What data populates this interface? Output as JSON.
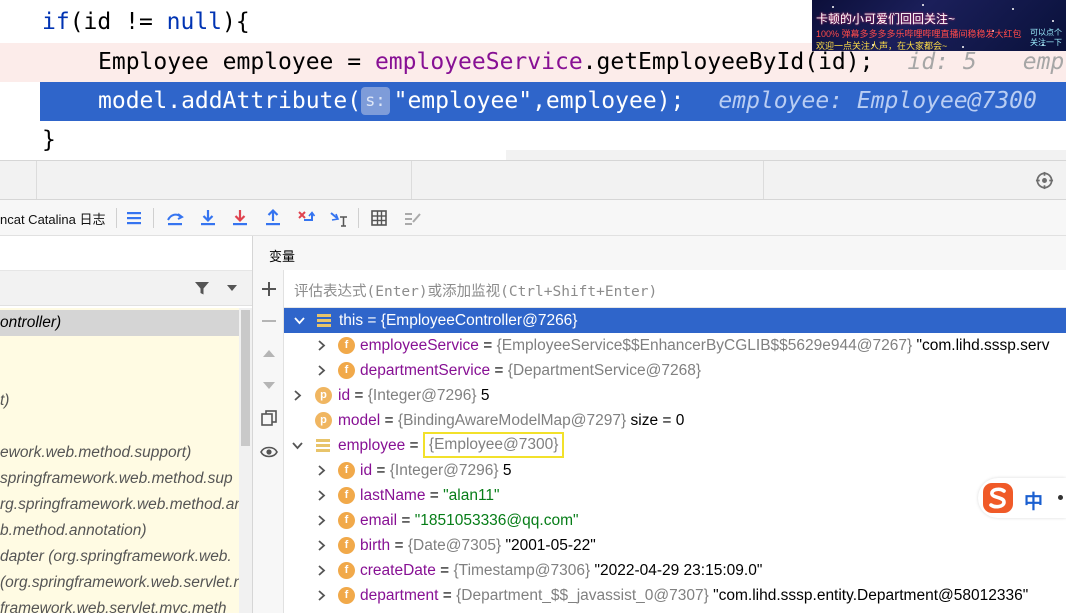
{
  "editor": {
    "line1": {
      "kw_if": "if",
      "text_a": "(id != ",
      "kw_null": "null",
      "text_b": "){"
    },
    "line2": {
      "type": "Employee employee = ",
      "field": "employeeService",
      "call": ".getEmployeeById(id);",
      "inline_value": "id: 5",
      "inline_value_cut": "emp"
    },
    "line3": {
      "call": "model.addAttribute(",
      "param_hint": "s:",
      "args": "\"employee\",employee);",
      "inline_value": "employee: Employee@7300"
    },
    "line4": {
      "text": "}"
    }
  },
  "overlay": {
    "line1": "卡顿的小可爱们回回关注~",
    "line2": "100% 弹幕多多多多乐哔哩哔哩直播间稳稳发大红包",
    "line3": "欢迎一点关注人声，在大家都会~",
    "line4": "可以点个",
    "line5": "关注一下"
  },
  "toolbar": {
    "tab_label": "ncat Catalina 日志",
    "icons": [
      "menu-icon",
      "show-execution-point-icon",
      "step-over-icon",
      "step-into-icon",
      "force-step-into-icon",
      "step-out-icon",
      "drop-frame-icon",
      "run-to-cursor-icon",
      "evaluate-icon",
      "trace-icon"
    ]
  },
  "frames": {
    "rows": [
      {
        "text": "ontroller)",
        "selected": true
      },
      {
        "text": "",
        "selected": false
      },
      {
        "text": "",
        "selected": false
      },
      {
        "text": "t)",
        "selected": false
      },
      {
        "text": "",
        "selected": false
      },
      {
        "text": "ework.web.method.support)",
        "selected": false
      },
      {
        "text": "springframework.web.method.sup",
        "selected": false
      },
      {
        "text": "rg.springframework.web.method.an",
        "selected": false
      },
      {
        "text": "b.method.annotation)",
        "selected": false
      },
      {
        "text": "dapter (org.springframework.web.",
        "selected": false
      },
      {
        "text": "(org.springframework.web.servlet.n",
        "selected": false
      },
      {
        "text": "framework.web.servlet.mvc.meth",
        "selected": false
      }
    ]
  },
  "variables": {
    "title": "变量",
    "eval_placeholder": "评估表达式(Enter)或添加监视(Ctrl+Shift+Enter)",
    "rows": {
      "this": {
        "name": "this",
        "eq": " = ",
        "value": "{EmployeeController@7266}"
      },
      "employeeService": {
        "badge": "f",
        "name": "employeeService",
        "eq": " = ",
        "obj": "{EmployeeService$$EnhancerByCGLIB$$5629e944@7267}",
        "tail": " \"com.lihd.sssp.serv"
      },
      "departmentService": {
        "badge": "f",
        "name": "departmentService",
        "eq": " = ",
        "obj": "{DepartmentService@7268}"
      },
      "id": {
        "badge": "p",
        "name": "id",
        "eq": " = ",
        "obj": "{Integer@7296}",
        "num": " 5"
      },
      "model": {
        "badge": "p",
        "name": "model",
        "eq": " = ",
        "obj": "{BindingAwareModelMap@7297}",
        "tail": "  size = 0"
      },
      "employee": {
        "name": "employee",
        "eq": " = ",
        "obj": "{Employee@7300}"
      },
      "emp_id": {
        "badge": "f",
        "name": "id",
        "eq": " = ",
        "obj": "{Integer@7296}",
        "num": " 5"
      },
      "lastName": {
        "badge": "f",
        "name": "lastName",
        "eq": " = ",
        "str": "\"alan11\""
      },
      "email": {
        "badge": "f",
        "name": "email",
        "eq": " = ",
        "str": "\"1851053336@qq.com\""
      },
      "birth": {
        "badge": "f",
        "name": "birth",
        "eq": " = ",
        "obj": "{Date@7305}",
        "tail": " \"2001-05-22\""
      },
      "createDate": {
        "badge": "f",
        "name": "createDate",
        "eq": " = ",
        "obj": "{Timestamp@7306}",
        "tail": " \"2022-04-29 23:15:09.0\""
      },
      "department": {
        "badge": "f",
        "name": "department",
        "eq": " = ",
        "obj": "{Department_$$_javassist_0@7307}",
        "tail": " \"com.lihd.sssp.entity.Department@58012336\""
      }
    }
  },
  "ime": {
    "label": "中"
  },
  "colors": {
    "selection": "#2f65ca",
    "keyword": "#0033b3",
    "field": "#871094",
    "string": "#067d17",
    "number": "#1750eb",
    "highlight_box": "#f2e12b"
  }
}
